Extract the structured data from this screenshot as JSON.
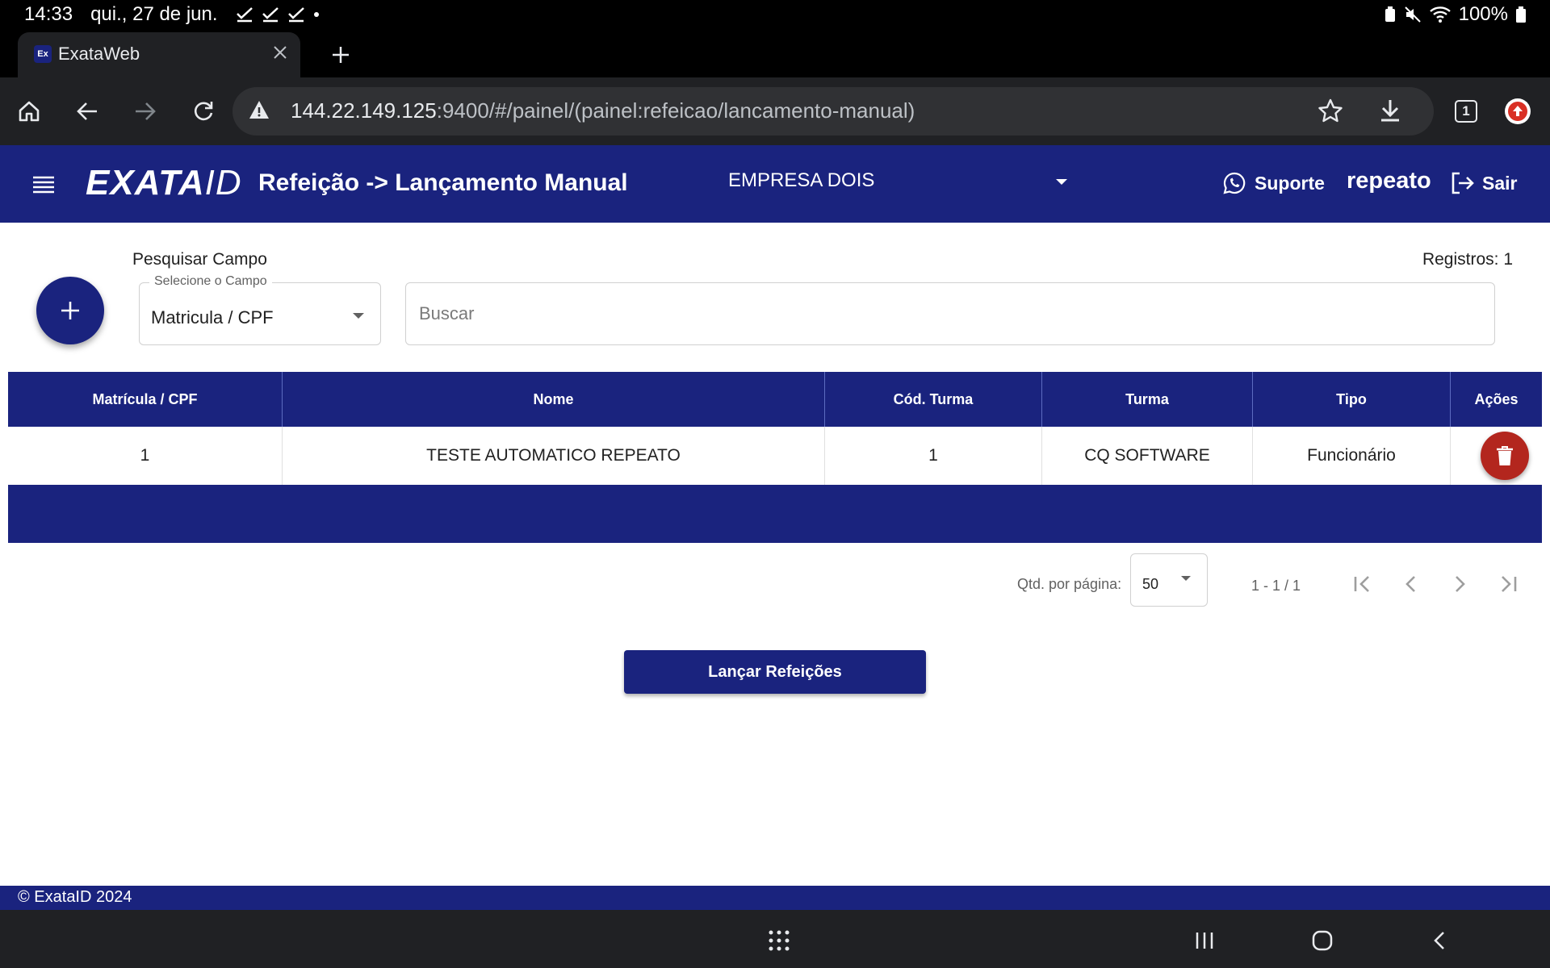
{
  "status_bar": {
    "time": "14:33",
    "date": "qui., 27 de jun.",
    "battery": "100%"
  },
  "browser": {
    "tab_title": "ExataWeb",
    "favicon_text": "Ex",
    "url_host": "144.22.149.125",
    "url_rest": ":9400/#/painel/(painel:refeicao/lancamento-manual)",
    "tab_count": "1"
  },
  "header": {
    "logo_main": "EXATA",
    "logo_id": "ID",
    "title": "Refeição -> Lançamento Manual",
    "company": "EMPRESA DOIS",
    "support_label": "Suporte",
    "username": "repeato",
    "logout_label": "Sair"
  },
  "search": {
    "section_label": "Pesquisar Campo",
    "field_label": "Selecione o Campo",
    "field_value": "Matricula / CPF",
    "placeholder": "Buscar",
    "records": "Registros: 1"
  },
  "table": {
    "columns": [
      "Matrícula / CPF",
      "Nome",
      "Cód. Turma",
      "Turma",
      "Tipo",
      "Ações"
    ],
    "rows": [
      {
        "matricula": "1",
        "nome": "TESTE AUTOMATICO REPEATO",
        "cod_turma": "1",
        "turma": "CQ SOFTWARE",
        "tipo": "Funcionário"
      }
    ]
  },
  "paginator": {
    "per_page_label": "Qtd. por página:",
    "per_page_value": "50",
    "range": "1 - 1 / 1"
  },
  "actions": {
    "launch_label": "Lançar Refeições"
  },
  "footer": {
    "copyright": "© ExataID 2024"
  },
  "colors": {
    "primary": "#1a237e",
    "danger": "#b3261e",
    "browser_bg": "#202124"
  }
}
